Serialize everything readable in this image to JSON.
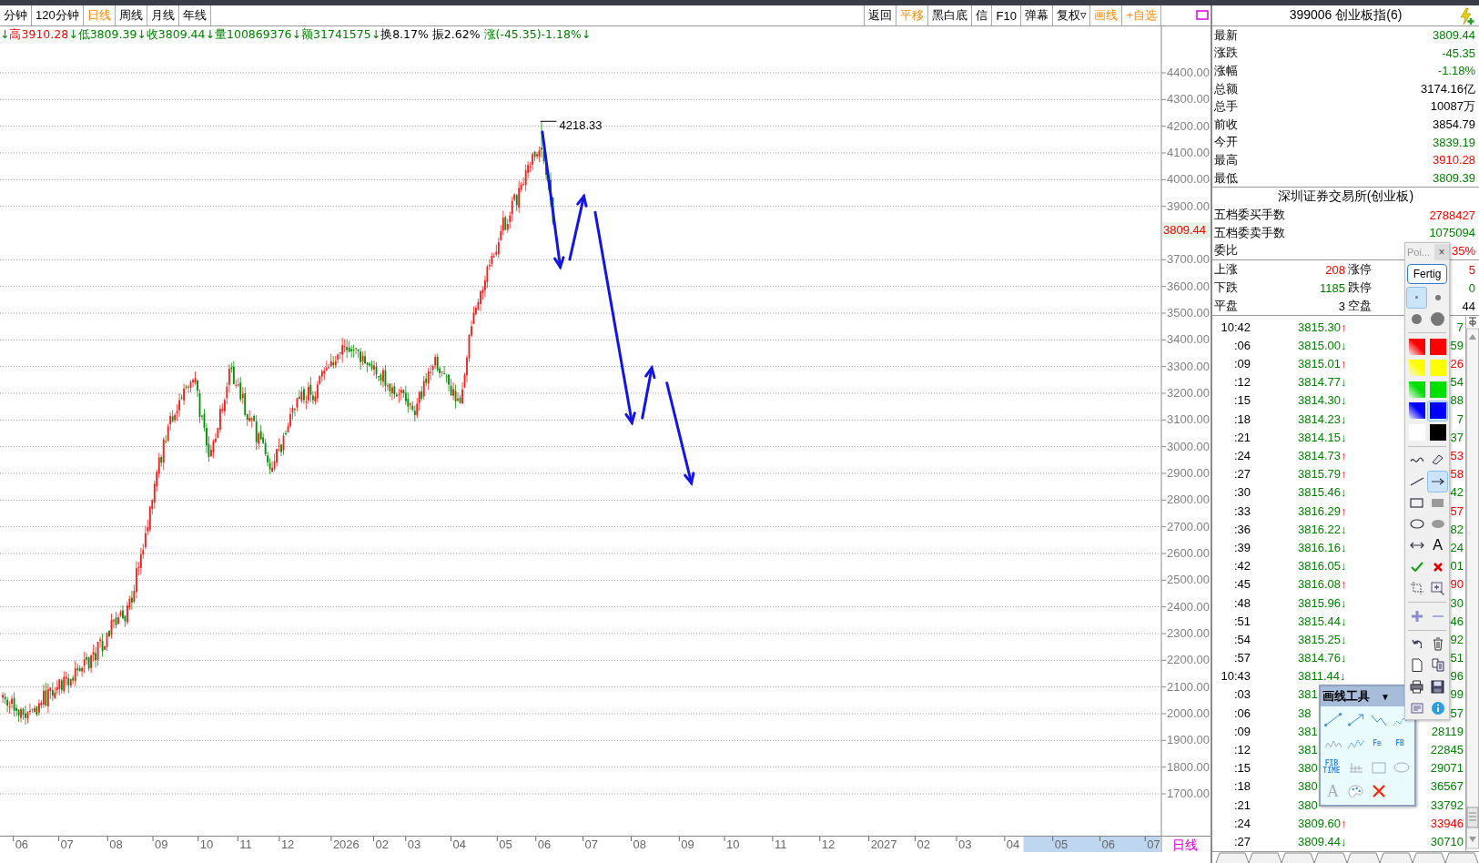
{
  "toolbar": {
    "period_tabs": [
      {
        "label": "分钟",
        "selected": false
      },
      {
        "label": "120分钟",
        "selected": false
      },
      {
        "label": "日线",
        "selected": true
      },
      {
        "label": "周线",
        "selected": false
      },
      {
        "label": "月线",
        "selected": false
      },
      {
        "label": "年线",
        "selected": false
      }
    ],
    "actions": [
      {
        "label": "返回",
        "active": false
      },
      {
        "label": "平移",
        "active": true
      },
      {
        "label": "黑白底",
        "active": false
      },
      {
        "label": "信",
        "active": false
      },
      {
        "label": "F10",
        "active": false
      },
      {
        "label": "弹幕",
        "active": false
      },
      {
        "label": "复权▿",
        "active": false
      },
      {
        "label": "画线",
        "active": true
      },
      {
        "label": "+自选",
        "active": true
      }
    ]
  },
  "info_line": [
    {
      "text": "↓",
      "color": "#008000"
    },
    {
      "text": "高3910.28",
      "color": "#ff0000"
    },
    {
      "text": "↓低3809.39↓收3809.44↓量100869376↓额31741575↓",
      "color": "#008000"
    },
    {
      "text": "换8.17% 振2.62% ",
      "color": "#000000"
    },
    {
      "text": "涨(-45.35)-1.18%↓",
      "color": "#008000"
    }
  ],
  "chart": {
    "y_labels": [
      "4400.00",
      "4300.00",
      "4200.00",
      "4100.00",
      "4000.00",
      "3900.00",
      "3700.00",
      "3600.00",
      "3500.00",
      "3400.00",
      "3300.00",
      "3200.00",
      "3100.00",
      "3000.00",
      "2900.00",
      "2800.00",
      "2700.00",
      "2600.00",
      "2500.00",
      "2400.00",
      "2300.00",
      "2200.00",
      "2100.00",
      "2000.00",
      "1900.00",
      "1800.00",
      "1700.00"
    ],
    "current_price": "3809.44",
    "peak_label": "4218.33",
    "x_labels": [
      "06",
      "07",
      "08",
      "09",
      "10",
      "11",
      "12",
      "2026",
      "02",
      "03",
      "04",
      "05",
      "06",
      "07",
      "08",
      "09",
      "10",
      "11",
      "12",
      "2027",
      "02",
      "03",
      "04",
      "05",
      "06",
      "07"
    ],
    "period_label": "日线"
  },
  "quote": {
    "title": "399006 创业板指(6)",
    "rows": [
      {
        "label": "最新",
        "value": "3809.44",
        "color": "#008000"
      },
      {
        "label": "涨跌",
        "value": "-45.35",
        "color": "#008000"
      },
      {
        "label": "涨幅",
        "value": "-1.18%",
        "color": "#008000"
      },
      {
        "label": "总额",
        "value": "3174.16亿",
        "color": "#000000"
      },
      {
        "label": "总手",
        "value": "10087万",
        "color": "#000000"
      },
      {
        "label": "前收",
        "value": "3854.79",
        "color": "#000000"
      },
      {
        "label": "今开",
        "value": "3839.19",
        "color": "#008000"
      },
      {
        "label": "最高",
        "value": "3910.28",
        "color": "#ff0000"
      },
      {
        "label": "最低",
        "value": "3809.39",
        "color": "#008000"
      }
    ],
    "exchange": "深圳证券交易所(创业板)",
    "order_rows": [
      {
        "label": "五档委买手数",
        "value": "2788427",
        "color": "#ff0000"
      },
      {
        "label": "五档委卖手数",
        "value": "1075094",
        "color": "#008000"
      },
      {
        "label": "委比",
        "value": "35%",
        "color": "#ff0000"
      }
    ],
    "breadth": [
      {
        "label": "上涨",
        "value": "208",
        "label2": "涨停",
        "value2": "5",
        "color": "#ff0000"
      },
      {
        "label": "下跌",
        "value": "1185",
        "label2": "跌停",
        "value2": "0",
        "color": "#008000"
      },
      {
        "label": "平盘",
        "value": "3",
        "label2": "空盘",
        "value2": "44",
        "color": "#000000"
      }
    ]
  },
  "ticks": [
    {
      "time": "10:42",
      "price": "3815.30",
      "arrow": "↑",
      "up": true,
      "volume": "7",
      "volume_up": false
    },
    {
      "time": ":06",
      "price": "3815.00",
      "arrow": "↓",
      "up": false,
      "volume": "59",
      "volume_up": false
    },
    {
      "time": ":09",
      "price": "3815.01",
      "arrow": "↑",
      "up": true,
      "volume": "26",
      "volume_up": true
    },
    {
      "time": ":12",
      "price": "3814.77",
      "arrow": "↓",
      "up": false,
      "volume": "54",
      "volume_up": false
    },
    {
      "time": ":15",
      "price": "3814.30",
      "arrow": "↓",
      "up": false,
      "volume": "88",
      "volume_up": false
    },
    {
      "time": ":18",
      "price": "3814.23",
      "arrow": "↓",
      "up": false,
      "volume": "7",
      "volume_up": false
    },
    {
      "time": ":21",
      "price": "3814.15",
      "arrow": "↓",
      "up": false,
      "volume": "37",
      "volume_up": false
    },
    {
      "time": ":24",
      "price": "3814.73",
      "arrow": "↑",
      "up": true,
      "volume": "53",
      "volume_up": true
    },
    {
      "time": ":27",
      "price": "3815.79",
      "arrow": "↑",
      "up": true,
      "volume": "58",
      "volume_up": true
    },
    {
      "time": ":30",
      "price": "3815.46",
      "arrow": "↓",
      "up": false,
      "volume": "42",
      "volume_up": false
    },
    {
      "time": ":33",
      "price": "3816.29",
      "arrow": "↑",
      "up": true,
      "volume": "57",
      "volume_up": true
    },
    {
      "time": ":36",
      "price": "3816.22",
      "arrow": "↓",
      "up": false,
      "volume": "82",
      "volume_up": false
    },
    {
      "time": ":39",
      "price": "3816.16",
      "arrow": "↓",
      "up": false,
      "volume": "24",
      "volume_up": false
    },
    {
      "time": ":42",
      "price": "3816.05",
      "arrow": "↓",
      "up": false,
      "volume": "01",
      "volume_up": false
    },
    {
      "time": ":45",
      "price": "3816.08",
      "arrow": "↑",
      "up": true,
      "volume": "90",
      "volume_up": true
    },
    {
      "time": ":48",
      "price": "3815.96",
      "arrow": "↓",
      "up": false,
      "volume": "30",
      "volume_up": false
    },
    {
      "time": ":51",
      "price": "3815.44",
      "arrow": "↓",
      "up": false,
      "volume": "46",
      "volume_up": false
    },
    {
      "time": ":54",
      "price": "3815.25",
      "arrow": "↓",
      "up": false,
      "volume": "92",
      "volume_up": false
    },
    {
      "time": ":57",
      "price": "3814.76",
      "arrow": "↓",
      "up": false,
      "volume": "51",
      "volume_up": false
    },
    {
      "time": "10:43",
      "price": "3811.44",
      "arrow": "↓",
      "up": false,
      "volume": "96",
      "volume_up": false
    },
    {
      "time": ":03",
      "price": "381",
      "volume": "99",
      "volume_up": false
    },
    {
      "time": ":06",
      "price": "38",
      "volume": "57",
      "volume_up": false
    },
    {
      "time": ":09",
      "price": "381",
      "volume": "28119",
      "volume_up": false
    },
    {
      "time": ":12",
      "price": "381",
      "volume": "22845",
      "volume_up": false
    },
    {
      "time": ":15",
      "price": "380",
      "volume": "29071",
      "volume_up": false
    },
    {
      "time": ":18",
      "price": "380",
      "volume": "36567",
      "volume_up": false
    },
    {
      "time": ":21",
      "price": "380",
      "volume": "33792",
      "volume_up": false
    },
    {
      "time": ":24",
      "price": "3809.60",
      "arrow": "↑",
      "up": true,
      "volume": "33946",
      "volume_up": true
    },
    {
      "time": ":27",
      "price": "3809.44",
      "arrow": "↓",
      "up": false,
      "volume": "30710",
      "volume_up": false
    }
  ],
  "pen_palette": {
    "title": "Poi...",
    "close": "×",
    "done": "Fertig",
    "sizes": [
      {
        "selected": true
      },
      {
        "selected": false
      },
      {
        "selected": false
      },
      {
        "selected": false
      }
    ],
    "colors": [
      {
        "color": "#ff0000",
        "gradient": true,
        "selected": false
      },
      {
        "color": "#ff0000",
        "gradient": false,
        "selected": false
      },
      {
        "color": "#ffff00",
        "gradient": true,
        "selected": false
      },
      {
        "color": "#ffff00",
        "gradient": false,
        "selected": false
      },
      {
        "color": "#00e000",
        "gradient": true,
        "selected": false
      },
      {
        "color": "#00e000",
        "gradient": false,
        "selected": false
      },
      {
        "color": "#0000ff",
        "gradient": true,
        "selected": false
      },
      {
        "color": "#0000ff",
        "gradient": false,
        "selected": true
      },
      {
        "color": "#ffffff",
        "gradient": false,
        "selected": false
      },
      {
        "color": "#000000",
        "gradient": false,
        "selected": false
      }
    ],
    "tool_groups": [
      {
        "tools": [
          {
            "kind": "curve",
            "selected": false
          },
          {
            "kind": "eraser",
            "selected": false
          },
          {
            "kind": "line",
            "selected": false
          },
          {
            "kind": "arrow",
            "selected": true
          },
          {
            "kind": "rect",
            "selected": false
          },
          {
            "kind": "filled-rect",
            "selected": false
          },
          {
            "kind": "ellipse",
            "selected": false
          },
          {
            "kind": "filled-ellipse",
            "selected": false
          },
          {
            "kind": "double-arrow",
            "selected": false
          },
          {
            "kind": "text",
            "label": "A",
            "selected": false
          },
          {
            "kind": "confirm",
            "selected": false
          },
          {
            "kind": "cross",
            "selected": false
          },
          {
            "kind": "crop",
            "selected": false
          },
          {
            "kind": "zoom",
            "selected": false
          }
        ]
      },
      {
        "tools": [
          {
            "kind": "plus",
            "selected": false
          },
          {
            "kind": "minus",
            "selected": false
          }
        ]
      },
      {
        "tools": [
          {
            "kind": "undo",
            "selected": false
          },
          {
            "kind": "trash",
            "selected": false
          },
          {
            "kind": "new-doc",
            "selected": false
          },
          {
            "kind": "copy",
            "selected": false
          },
          {
            "kind": "print",
            "selected": false
          },
          {
            "kind": "save",
            "selected": false
          },
          {
            "kind": "note",
            "selected": false
          },
          {
            "kind": "info",
            "selected": false
          }
        ]
      }
    ]
  },
  "draw_tools": {
    "title": "画线工具",
    "menu": "▼",
    "tools": [
      {
        "kind": "segment"
      },
      {
        "kind": "ray"
      },
      {
        "kind": "zigzag"
      },
      {
        "kind": "wave"
      },
      {
        "kind": "wave-faint"
      },
      {
        "kind": "wave-dashed"
      },
      {
        "kind": "label",
        "label": "F≡"
      },
      {
        "kind": "label",
        "label": "FB"
      },
      {
        "kind": "label",
        "label": "FIB TIME"
      },
      {
        "kind": "gauge"
      },
      {
        "kind": "rect"
      },
      {
        "kind": "ellipse"
      },
      {
        "kind": "text",
        "label": "A"
      },
      {
        "kind": "palette"
      },
      {
        "kind": "delete"
      }
    ]
  }
}
